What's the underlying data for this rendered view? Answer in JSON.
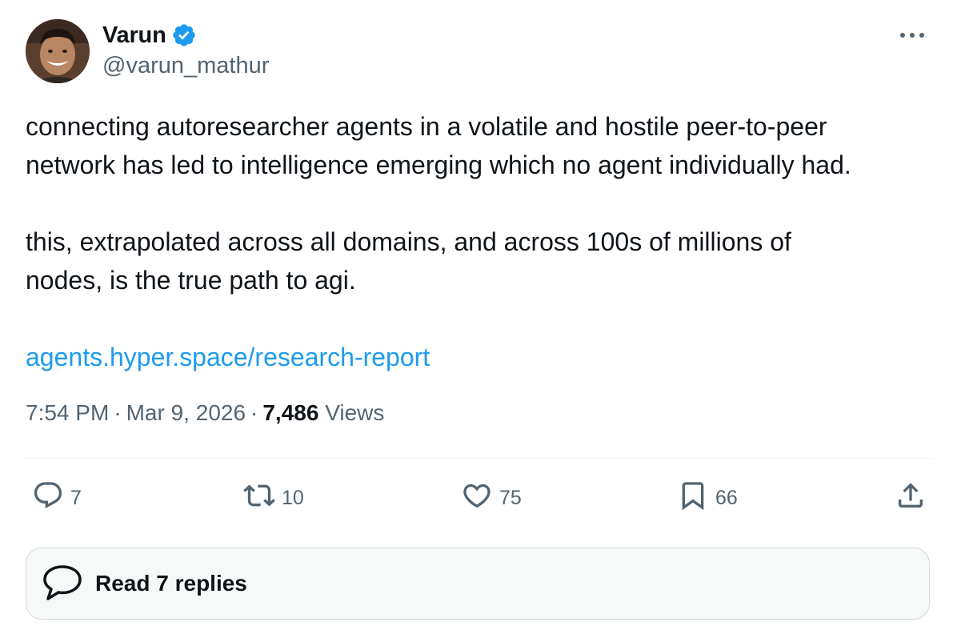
{
  "author": {
    "display_name": "Varun",
    "handle": "@varun_mathur",
    "verified": true,
    "verified_color": "#1d9bf0"
  },
  "tweet": {
    "paragraph_1_line_1": "connecting autoresearcher agents in a volatile and hostile peer-to-peer",
    "paragraph_1_line_2": "network has led to intelligence emerging which no agent individually had.",
    "paragraph_2_line_1": "this, extrapolated across all domains, and across 100s of millions of",
    "paragraph_2_line_2": "nodes, is the true path to agi.",
    "link_text": "agents.hyper.space/research-report",
    "link_color": "#1d9bf0"
  },
  "meta": {
    "time": "7:54 PM",
    "date": "Mar 9, 2026",
    "views_count": "7,486",
    "views_label": "Views"
  },
  "actions": {
    "replies": "7",
    "reposts": "10",
    "likes": "75",
    "bookmarks": "66",
    "icons": [
      "reply-icon",
      "retweet-icon",
      "like-icon",
      "bookmark-icon",
      "share-icon"
    ]
  },
  "read_replies_label": "Read 7 replies",
  "more_icon": "more-icon"
}
